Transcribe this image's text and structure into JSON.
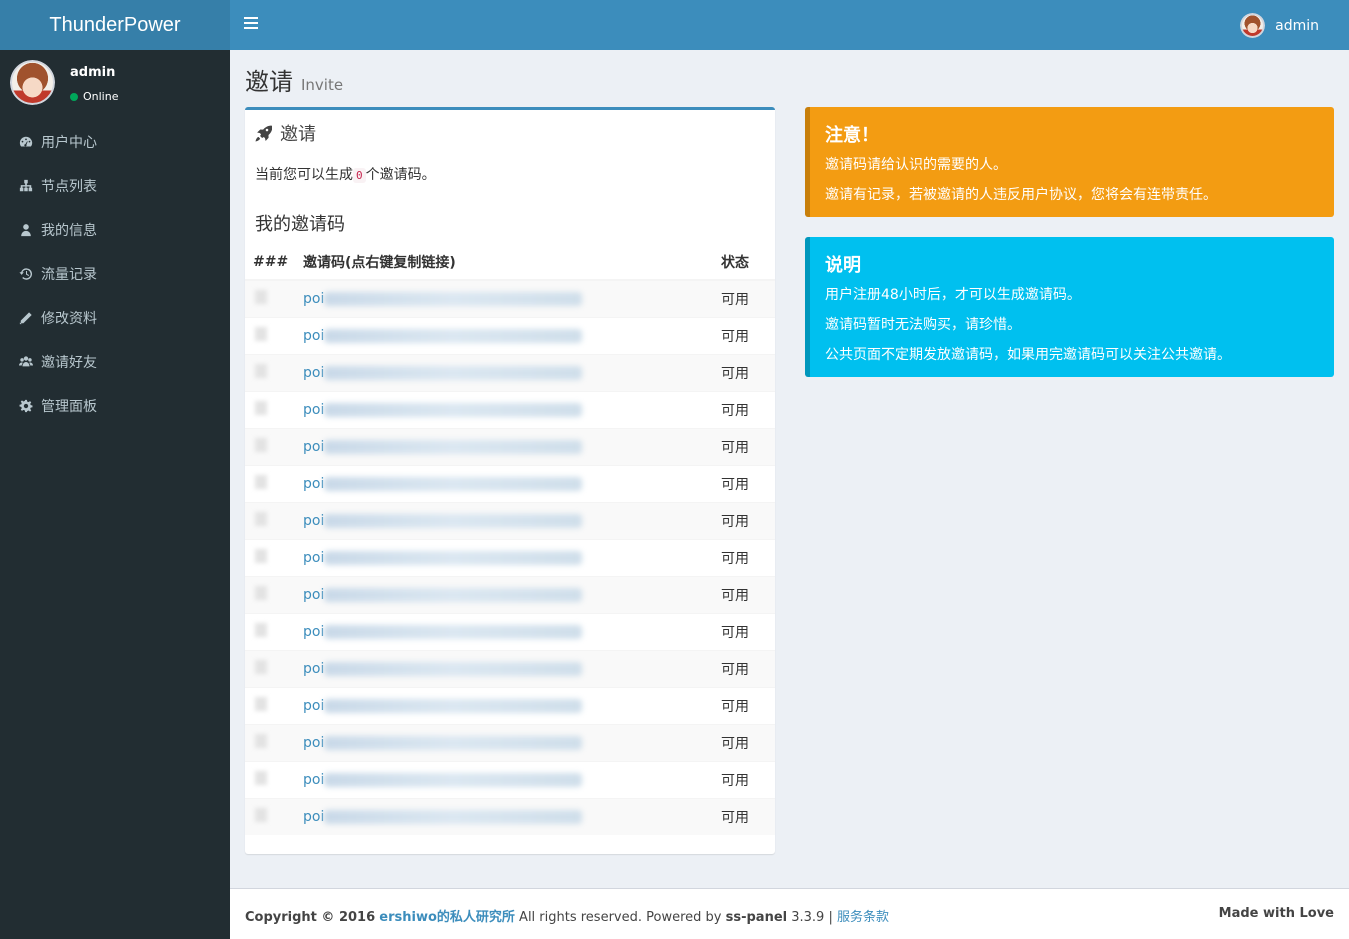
{
  "app": {
    "logo": "ThunderPower"
  },
  "header": {
    "user_name": "admin"
  },
  "sidebar": {
    "user_name": "admin",
    "status": "Online",
    "items": [
      {
        "label": "用户中心",
        "icon": "dashboard-icon"
      },
      {
        "label": "节点列表",
        "icon": "sitemap-icon"
      },
      {
        "label": "我的信息",
        "icon": "user-icon"
      },
      {
        "label": "流量记录",
        "icon": "history-icon"
      },
      {
        "label": "修改资料",
        "icon": "pencil-icon"
      },
      {
        "label": "邀请好友",
        "icon": "users-icon"
      },
      {
        "label": "管理面板",
        "icon": "gear-icon"
      }
    ]
  },
  "page": {
    "title": "邀请",
    "subtitle": "Invite"
  },
  "invite_box": {
    "title": "邀请",
    "available_prefix": "当前您可以生成",
    "available_count": "0",
    "available_suffix": "个邀请码。",
    "my_codes_heading": "我的邀请码",
    "table": {
      "headers": [
        "###",
        "邀请码(点右键复制链接)",
        "状态"
      ],
      "rows": [
        {
          "code_prefix": "poi",
          "status": "可用"
        },
        {
          "code_prefix": "poi",
          "status": "可用"
        },
        {
          "code_prefix": "poi",
          "status": "可用"
        },
        {
          "code_prefix": "poi",
          "status": "可用"
        },
        {
          "code_prefix": "poi",
          "status": "可用"
        },
        {
          "code_prefix": "poi",
          "status": "可用"
        },
        {
          "code_prefix": "poi",
          "status": "可用"
        },
        {
          "code_prefix": "poi",
          "status": "可用"
        },
        {
          "code_prefix": "poi",
          "status": "可用"
        },
        {
          "code_prefix": "poi",
          "status": "可用"
        },
        {
          "code_prefix": "poi",
          "status": "可用"
        },
        {
          "code_prefix": "poi",
          "status": "可用"
        },
        {
          "code_prefix": "poi",
          "status": "可用"
        },
        {
          "code_prefix": "poi",
          "status": "可用"
        },
        {
          "code_prefix": "poi",
          "status": "可用"
        }
      ]
    }
  },
  "notice": {
    "title": "注意！",
    "lines": [
      "邀请码请给认识的需要的人。",
      "邀请有记录，若被邀请的人违反用户协议，您将会有连带责任。"
    ]
  },
  "info": {
    "title": "说明",
    "lines": [
      "用户注册48小时后，才可以生成邀请码。",
      "邀请码暂时无法购买，请珍惜。",
      "公共页面不定期发放邀请码，如果用完邀请码可以关注公共邀请。"
    ]
  },
  "footer": {
    "copyright": "Copyright © 2016",
    "site_link": "ershiwo的私人研究所",
    "rights": "All rights reserved. Powered by",
    "powered": "ss-panel",
    "version": "3.3.9 |",
    "terms_link": "服务条款",
    "right_text": "Made with Love"
  },
  "colors": {
    "header": "#3c8dbc",
    "logo_bg": "#367fa9",
    "sidebar": "#222d32",
    "warning": "#f39c12",
    "info": "#00c0ef",
    "link": "#3c8dbc"
  }
}
